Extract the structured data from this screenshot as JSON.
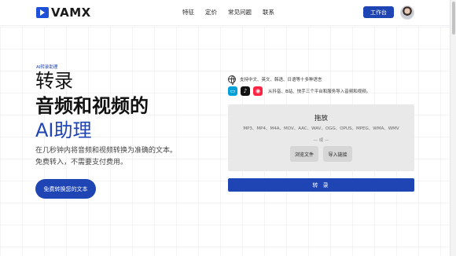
{
  "header": {
    "logo_text": "VAMX",
    "nav": [
      "特征",
      "定价",
      "常见问题",
      "联系"
    ],
    "workbench_label": "工作台"
  },
  "hero": {
    "tag": "AI转录助理",
    "title_line1": "转录",
    "title_line2": "音频和视频的",
    "title_line3": "AI助理",
    "desc_line1": "在几秒钟内将音频和视频转换为准确的文本。",
    "desc_line2": "免费转入，不需要支付费用。",
    "cta_label": "免费转换您的文本"
  },
  "upload": {
    "languages_text": "支持中文、英文、韩语、日语等十多种语言",
    "platforms_text": "从抖音、B站、快手三个平台和服务导入音频和视频。",
    "platform_icons": [
      "bilibili-icon",
      "tiktok-icon",
      "xiaohongshu-icon"
    ],
    "drop_title": "拖放",
    "formats": "MP3、MP4、M4A、MOV、AAC、WAV、OGG、OPUS、MPEG、WMA、WMV",
    "or_text": "— 或 —",
    "browse_label": "浏览文件",
    "import_label": "导入链接",
    "transcribe_label": "转 录"
  },
  "colors": {
    "accent": "#1f44b3",
    "dropzone_bg": "#e9e9e9"
  }
}
